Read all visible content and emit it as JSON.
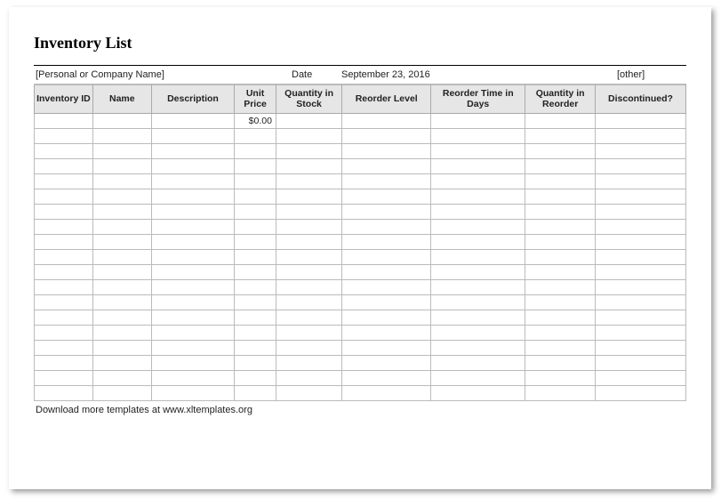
{
  "title": "Inventory List",
  "meta": {
    "company": "[Personal or Company Name]",
    "date_label": "Date",
    "date_value": "September 23, 2016",
    "other": "[other]"
  },
  "columns": {
    "inventory_id": "Inventory ID",
    "name": "Name",
    "description": "Description",
    "unit_price": "Unit Price",
    "qty_in_stock": "Quantity in Stock",
    "reorder_level": "Reorder Level",
    "reorder_time_days": "Reorder Time in Days",
    "qty_in_reorder": "Quantity in Reorder",
    "discontinued": "Discontinued?"
  },
  "rows": [
    {
      "inventory_id": "",
      "name": "",
      "description": "",
      "unit_price": "$0.00",
      "qty_in_stock": "",
      "reorder_level": "",
      "reorder_time_days": "",
      "qty_in_reorder": "",
      "discontinued": ""
    },
    {
      "inventory_id": "",
      "name": "",
      "description": "",
      "unit_price": "",
      "qty_in_stock": "",
      "reorder_level": "",
      "reorder_time_days": "",
      "qty_in_reorder": "",
      "discontinued": ""
    },
    {
      "inventory_id": "",
      "name": "",
      "description": "",
      "unit_price": "",
      "qty_in_stock": "",
      "reorder_level": "",
      "reorder_time_days": "",
      "qty_in_reorder": "",
      "discontinued": ""
    },
    {
      "inventory_id": "",
      "name": "",
      "description": "",
      "unit_price": "",
      "qty_in_stock": "",
      "reorder_level": "",
      "reorder_time_days": "",
      "qty_in_reorder": "",
      "discontinued": ""
    },
    {
      "inventory_id": "",
      "name": "",
      "description": "",
      "unit_price": "",
      "qty_in_stock": "",
      "reorder_level": "",
      "reorder_time_days": "",
      "qty_in_reorder": "",
      "discontinued": ""
    },
    {
      "inventory_id": "",
      "name": "",
      "description": "",
      "unit_price": "",
      "qty_in_stock": "",
      "reorder_level": "",
      "reorder_time_days": "",
      "qty_in_reorder": "",
      "discontinued": ""
    },
    {
      "inventory_id": "",
      "name": "",
      "description": "",
      "unit_price": "",
      "qty_in_stock": "",
      "reorder_level": "",
      "reorder_time_days": "",
      "qty_in_reorder": "",
      "discontinued": ""
    },
    {
      "inventory_id": "",
      "name": "",
      "description": "",
      "unit_price": "",
      "qty_in_stock": "",
      "reorder_level": "",
      "reorder_time_days": "",
      "qty_in_reorder": "",
      "discontinued": ""
    },
    {
      "inventory_id": "",
      "name": "",
      "description": "",
      "unit_price": "",
      "qty_in_stock": "",
      "reorder_level": "",
      "reorder_time_days": "",
      "qty_in_reorder": "",
      "discontinued": ""
    },
    {
      "inventory_id": "",
      "name": "",
      "description": "",
      "unit_price": "",
      "qty_in_stock": "",
      "reorder_level": "",
      "reorder_time_days": "",
      "qty_in_reorder": "",
      "discontinued": ""
    },
    {
      "inventory_id": "",
      "name": "",
      "description": "",
      "unit_price": "",
      "qty_in_stock": "",
      "reorder_level": "",
      "reorder_time_days": "",
      "qty_in_reorder": "",
      "discontinued": ""
    },
    {
      "inventory_id": "",
      "name": "",
      "description": "",
      "unit_price": "",
      "qty_in_stock": "",
      "reorder_level": "",
      "reorder_time_days": "",
      "qty_in_reorder": "",
      "discontinued": ""
    },
    {
      "inventory_id": "",
      "name": "",
      "description": "",
      "unit_price": "",
      "qty_in_stock": "",
      "reorder_level": "",
      "reorder_time_days": "",
      "qty_in_reorder": "",
      "discontinued": ""
    },
    {
      "inventory_id": "",
      "name": "",
      "description": "",
      "unit_price": "",
      "qty_in_stock": "",
      "reorder_level": "",
      "reorder_time_days": "",
      "qty_in_reorder": "",
      "discontinued": ""
    },
    {
      "inventory_id": "",
      "name": "",
      "description": "",
      "unit_price": "",
      "qty_in_stock": "",
      "reorder_level": "",
      "reorder_time_days": "",
      "qty_in_reorder": "",
      "discontinued": ""
    },
    {
      "inventory_id": "",
      "name": "",
      "description": "",
      "unit_price": "",
      "qty_in_stock": "",
      "reorder_level": "",
      "reorder_time_days": "",
      "qty_in_reorder": "",
      "discontinued": ""
    },
    {
      "inventory_id": "",
      "name": "",
      "description": "",
      "unit_price": "",
      "qty_in_stock": "",
      "reorder_level": "",
      "reorder_time_days": "",
      "qty_in_reorder": "",
      "discontinued": ""
    },
    {
      "inventory_id": "",
      "name": "",
      "description": "",
      "unit_price": "",
      "qty_in_stock": "",
      "reorder_level": "",
      "reorder_time_days": "",
      "qty_in_reorder": "",
      "discontinued": ""
    },
    {
      "inventory_id": "",
      "name": "",
      "description": "",
      "unit_price": "",
      "qty_in_stock": "",
      "reorder_level": "",
      "reorder_time_days": "",
      "qty_in_reorder": "",
      "discontinued": ""
    }
  ],
  "footer": "Download more templates at www.xltemplates.org"
}
